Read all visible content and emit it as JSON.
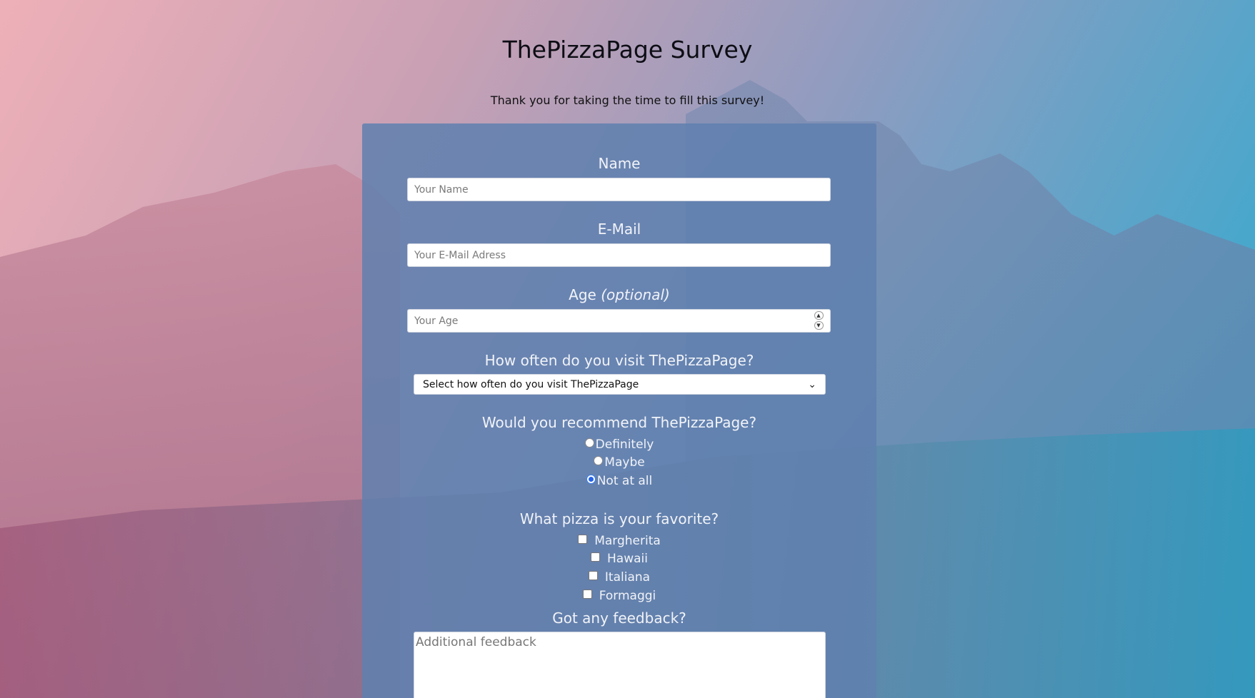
{
  "header": {
    "title": "ThePizzaPage Survey",
    "subtitle": "Thank you for taking the time to fill this survey!"
  },
  "form": {
    "name": {
      "label": "Name",
      "placeholder": "Your Name",
      "value": ""
    },
    "email": {
      "label": "E-Mail",
      "placeholder": "Your E-Mail Adress",
      "value": ""
    },
    "age": {
      "label": "Age",
      "label_optional": "(optional)",
      "placeholder": "Your Age",
      "value": ""
    },
    "visit": {
      "label": "How often do you visit ThePizzaPage?",
      "selected": "Select how often do you visit ThePizzaPage"
    },
    "recommend": {
      "label": "Would you recommend ThePizzaPage?",
      "options": [
        {
          "label": "Definitely",
          "checked": false
        },
        {
          "label": "Maybe",
          "checked": false
        },
        {
          "label": "Not at all",
          "checked": true
        }
      ]
    },
    "favorite": {
      "label": "What pizza is your favorite?",
      "options": [
        {
          "label": "Margherita",
          "checked": false
        },
        {
          "label": "Hawaii",
          "checked": false
        },
        {
          "label": "Italiana",
          "checked": false
        },
        {
          "label": "Formaggi",
          "checked": false
        }
      ]
    },
    "feedback": {
      "label": "Got any feedback?",
      "placeholder": "Additional feedback",
      "value": ""
    }
  },
  "icons": {
    "select_arrow": "chevron-down-icon",
    "spinner": "number-spinner-icon"
  },
  "colors": {
    "card": "#5f80af",
    "radio_selected": "#2563eb"
  }
}
